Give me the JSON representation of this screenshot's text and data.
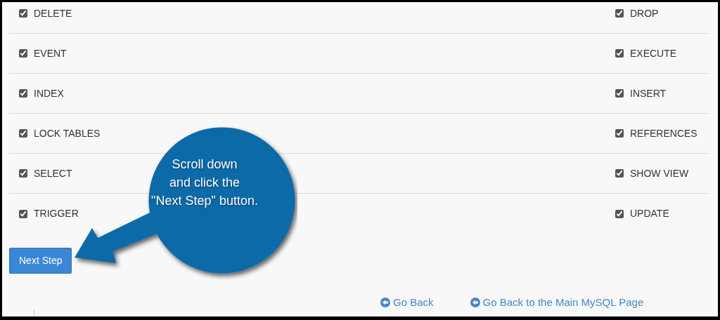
{
  "privileges": [
    {
      "label": "DELETE",
      "checked": true
    },
    {
      "label": "DROP",
      "checked": true
    },
    {
      "label": "EVENT",
      "checked": true
    },
    {
      "label": "EXECUTE",
      "checked": true
    },
    {
      "label": "INDEX",
      "checked": true
    },
    {
      "label": "INSERT",
      "checked": true
    },
    {
      "label": "LOCK TABLES",
      "checked": true
    },
    {
      "label": "REFERENCES",
      "checked": true
    },
    {
      "label": "SELECT",
      "checked": true
    },
    {
      "label": "SHOW VIEW",
      "checked": true
    },
    {
      "label": "TRIGGER",
      "checked": true
    },
    {
      "label": "UPDATE",
      "checked": true
    }
  ],
  "next_button": "Next Step",
  "links": [
    "Go Back",
    "Go Back to the Main MySQL Page"
  ],
  "callout": {
    "lines": [
      "Scroll down",
      "and click the",
      "\"Next Step\" button."
    ]
  }
}
